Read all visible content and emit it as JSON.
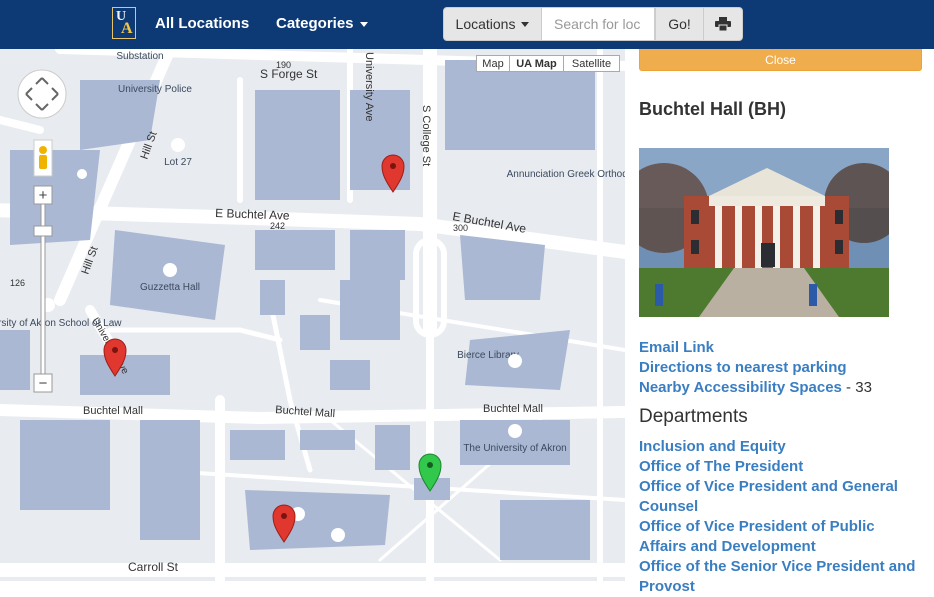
{
  "nav": {
    "logo_letters": "UA",
    "all_locations": "All Locations",
    "categories": "Categories",
    "locations_btn": "Locations",
    "search_placeholder": "Search for loc",
    "go_label": "Go!",
    "print_icon": "print-icon"
  },
  "map": {
    "type_buttons": [
      "Map",
      "UA Map",
      "Satellite"
    ],
    "streets": {
      "s_forge": "S Forge St",
      "e_buchtel_w": "E Buchtel Ave",
      "e_buchtel_e": "E Buchtel Ave",
      "hill_n": "Hill St",
      "hill_s": "Hill St",
      "buchtel_mall_w": "Buchtel Mall",
      "buchtel_mall_c": "Buchtel Mall",
      "buchtel_mall_e": "Buchtel Mall",
      "college": "S College St",
      "carroll": "Carroll St",
      "university_ave": "University Ave",
      "num_190": "190",
      "num_242": "242",
      "num_300": "300",
      "num_126": "126"
    },
    "places": {
      "substation": "Substation",
      "university_police": "University Police",
      "lot27": "Lot 27",
      "annunciation": "Annunciation Greek Orthodox Church",
      "guzzetta": "Guzzetta Hall",
      "law": "The University of Akron School of Law",
      "bierce": "Bierce Library",
      "ua": "The University of Akron"
    },
    "controls": {
      "zoom_in": "+",
      "zoom_out": "−"
    },
    "colors": {
      "building": "#aab8d3",
      "road": "#ffffff",
      "ground": "#e8ebef",
      "pin_red": "#e0372e",
      "pin_green": "#31c84b"
    }
  },
  "panel": {
    "close_label": "Close",
    "building_title": "Buchtel Hall (BH)",
    "links": {
      "email": "Email Link",
      "directions": "Directions to nearest parking",
      "accessibility": "Nearby Accessibility Spaces",
      "accessibility_sep": " - ",
      "accessibility_count": "33"
    },
    "departments_heading": "Departments",
    "departments": [
      "Inclusion and Equity",
      "Office of The President",
      "Office of Vice President and General Counsel",
      "Office of Vice President of Public Affairs and Development",
      "Office of the Senior Vice President and Provost"
    ]
  }
}
